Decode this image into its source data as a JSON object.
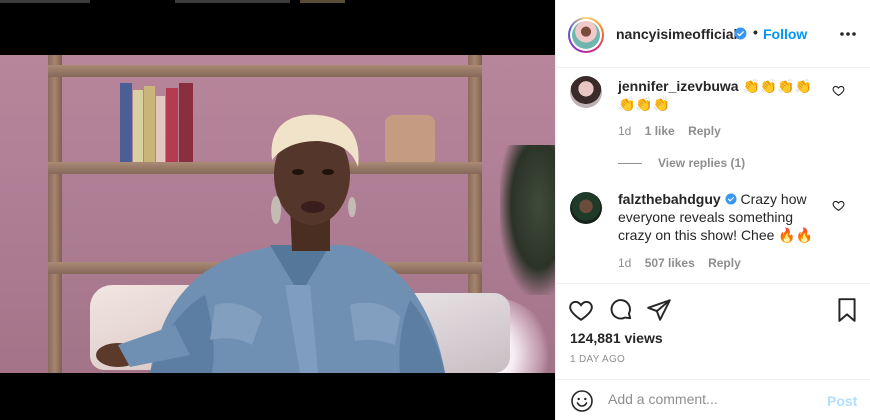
{
  "post": {
    "author": "nancyisimeofficial",
    "separator": "•",
    "follow_label": "Follow"
  },
  "comments": [
    {
      "username": "jennifer_izevbuwa",
      "text": "👏👏👏👏👏👏👏",
      "time": "1d",
      "likes": "1 like",
      "reply_label": "Reply",
      "view_replies": "View replies (1)"
    },
    {
      "username": "falzthebahdguy",
      "text": "Crazy how everyone reveals something crazy on this show! Chee 🔥🔥",
      "time": "1d",
      "likes": "507 likes",
      "reply_label": "Reply"
    }
  ],
  "stats": {
    "views": "124,881 views",
    "time_ago": "1 DAY AGO"
  },
  "comment_box": {
    "placeholder": "Add a comment...",
    "post_label": "Post"
  },
  "icons": {
    "more": "more-options-icon",
    "heart": "heart-icon",
    "comment": "comment-icon",
    "share": "share-icon",
    "save": "bookmark-icon",
    "emoji": "emoji-icon",
    "verified": "verified-badge-icon",
    "mute": "muted-speaker-icon"
  },
  "colors": {
    "link_blue": "#0095f6",
    "post_disabled": "#b2dffc",
    "muted_text": "#8e8e8e",
    "text": "#262626"
  }
}
